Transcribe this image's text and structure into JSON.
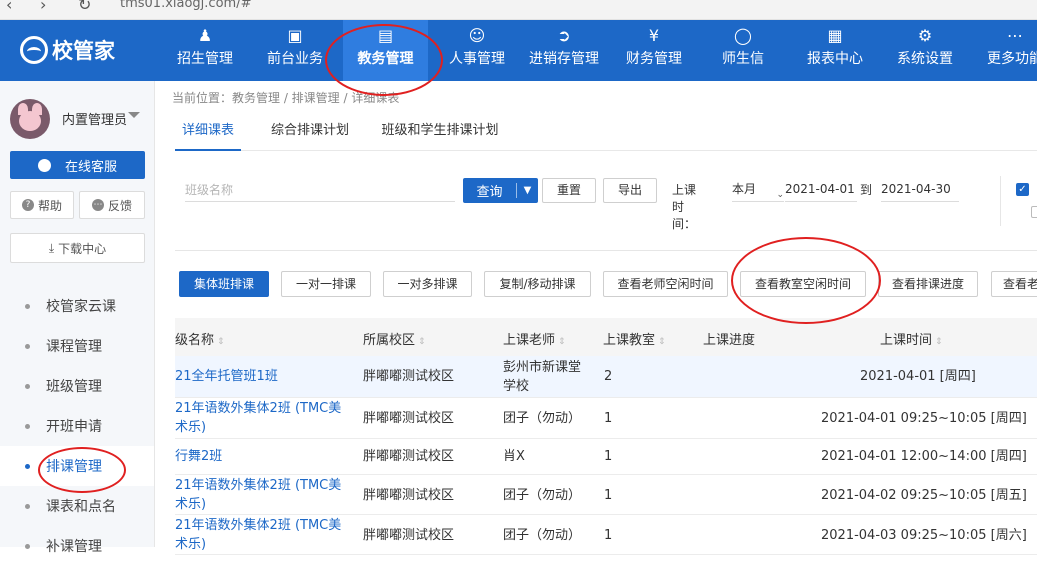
{
  "browser": {
    "url": "tms01.xiaogj.com/#"
  },
  "brand": {
    "name": "校管家"
  },
  "nav": [
    {
      "label": "招生管理",
      "icon": "user-plus-icon"
    },
    {
      "label": "前台业务",
      "icon": "monitor-icon"
    },
    {
      "label": "教务管理",
      "icon": "book-icon",
      "active": true
    },
    {
      "label": "人事管理",
      "icon": "person-icon"
    },
    {
      "label": "进销存管理",
      "icon": "inventory-icon"
    },
    {
      "label": "财务管理",
      "icon": "money-icon"
    },
    {
      "label": "师生信",
      "icon": "chat-icon"
    },
    {
      "label": "报表中心",
      "icon": "report-icon"
    },
    {
      "label": "系统设置",
      "icon": "settings-icon"
    },
    {
      "label": "更多功能",
      "icon": "more-icon"
    }
  ],
  "user": {
    "name": "内置管理员"
  },
  "sidebar": {
    "service_label": "在线客服",
    "help_label": "帮助",
    "feedback_label": "反馈",
    "download_label": "下载中心",
    "items": [
      {
        "label": "校管家云课"
      },
      {
        "label": "课程管理"
      },
      {
        "label": "班级管理"
      },
      {
        "label": "开班申请"
      },
      {
        "label": "排课管理",
        "active": true
      },
      {
        "label": "课表和点名"
      },
      {
        "label": "补课管理"
      }
    ]
  },
  "breadcrumb": "当前位置：教务管理 / 排课管理 / 详细课表",
  "tabs": [
    {
      "label": "详细课表",
      "active": true
    },
    {
      "label": "综合排课计划"
    },
    {
      "label": "班级和学生排课计划"
    }
  ],
  "filters": {
    "class_placeholder": "班级名称",
    "query_label": "查询",
    "reset_label": "重置",
    "export_label": "导出",
    "time_label": "上课时间：",
    "range_value": "本月",
    "date_start": "2021-04-01",
    "to_label": "到",
    "date_end": "2021-04-30"
  },
  "actions": [
    {
      "label": "集体班排课",
      "primary": true
    },
    {
      "label": "一对一排课"
    },
    {
      "label": "一对多排课"
    },
    {
      "label": "复制/移动排课"
    },
    {
      "label": "查看老师空闲时间"
    },
    {
      "label": "查看教室空闲时间"
    },
    {
      "label": "查看排课进度"
    },
    {
      "label": "查看老"
    }
  ],
  "table": {
    "headers": [
      "级名称",
      "所属校区",
      "上课老师",
      "上课教室",
      "上课进度",
      "上课时间"
    ],
    "rows": [
      {
        "name": "21全年托管班1班",
        "campus": "胖嘟嘟测试校区",
        "teacher": "彭州市新课堂学校",
        "room": "2",
        "progress": "",
        "time": "2021-04-01 [周四]"
      },
      {
        "name": "21年语数外集体2班 (TMC美术乐)",
        "campus": "胖嘟嘟测试校区",
        "teacher": "团子（勿动）",
        "room": "1",
        "progress": "",
        "time": "2021-04-01 09:25~10:05 [周四]"
      },
      {
        "name": "行舞2班",
        "campus": "胖嘟嘟测试校区",
        "teacher": "肖X",
        "room": "1",
        "progress": "",
        "time": "2021-04-01 12:00~14:00 [周四]"
      },
      {
        "name": "21年语数外集体2班 (TMC美术乐)",
        "campus": "胖嘟嘟测试校区",
        "teacher": "团子（勿动）",
        "room": "1",
        "progress": "",
        "time": "2021-04-02 09:25~10:05 [周五]"
      },
      {
        "name": "21年语数外集体2班 (TMC美术乐)",
        "campus": "胖嘟嘟测试校区",
        "teacher": "团子（勿动）",
        "room": "1",
        "progress": "",
        "time": "2021-04-03 09:25~10:05 [周六]"
      }
    ]
  }
}
